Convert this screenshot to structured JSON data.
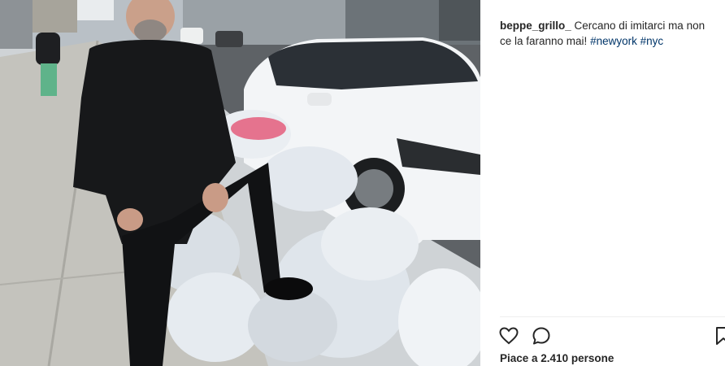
{
  "post": {
    "username": "beppe_grillo_",
    "caption_text": " Cercano di imitarci ma non ce la faranno mai! ",
    "hashtags": [
      "#newyork",
      "#nyc"
    ]
  },
  "actions": {
    "like_icon": "heart-icon",
    "comment_icon": "comment-icon",
    "save_icon": "bookmark-icon"
  },
  "likes": {
    "text": "Piace a 2.410 persone"
  },
  "colors": {
    "text": "#262626",
    "hashtag": "#003569",
    "divider": "#efefef"
  }
}
